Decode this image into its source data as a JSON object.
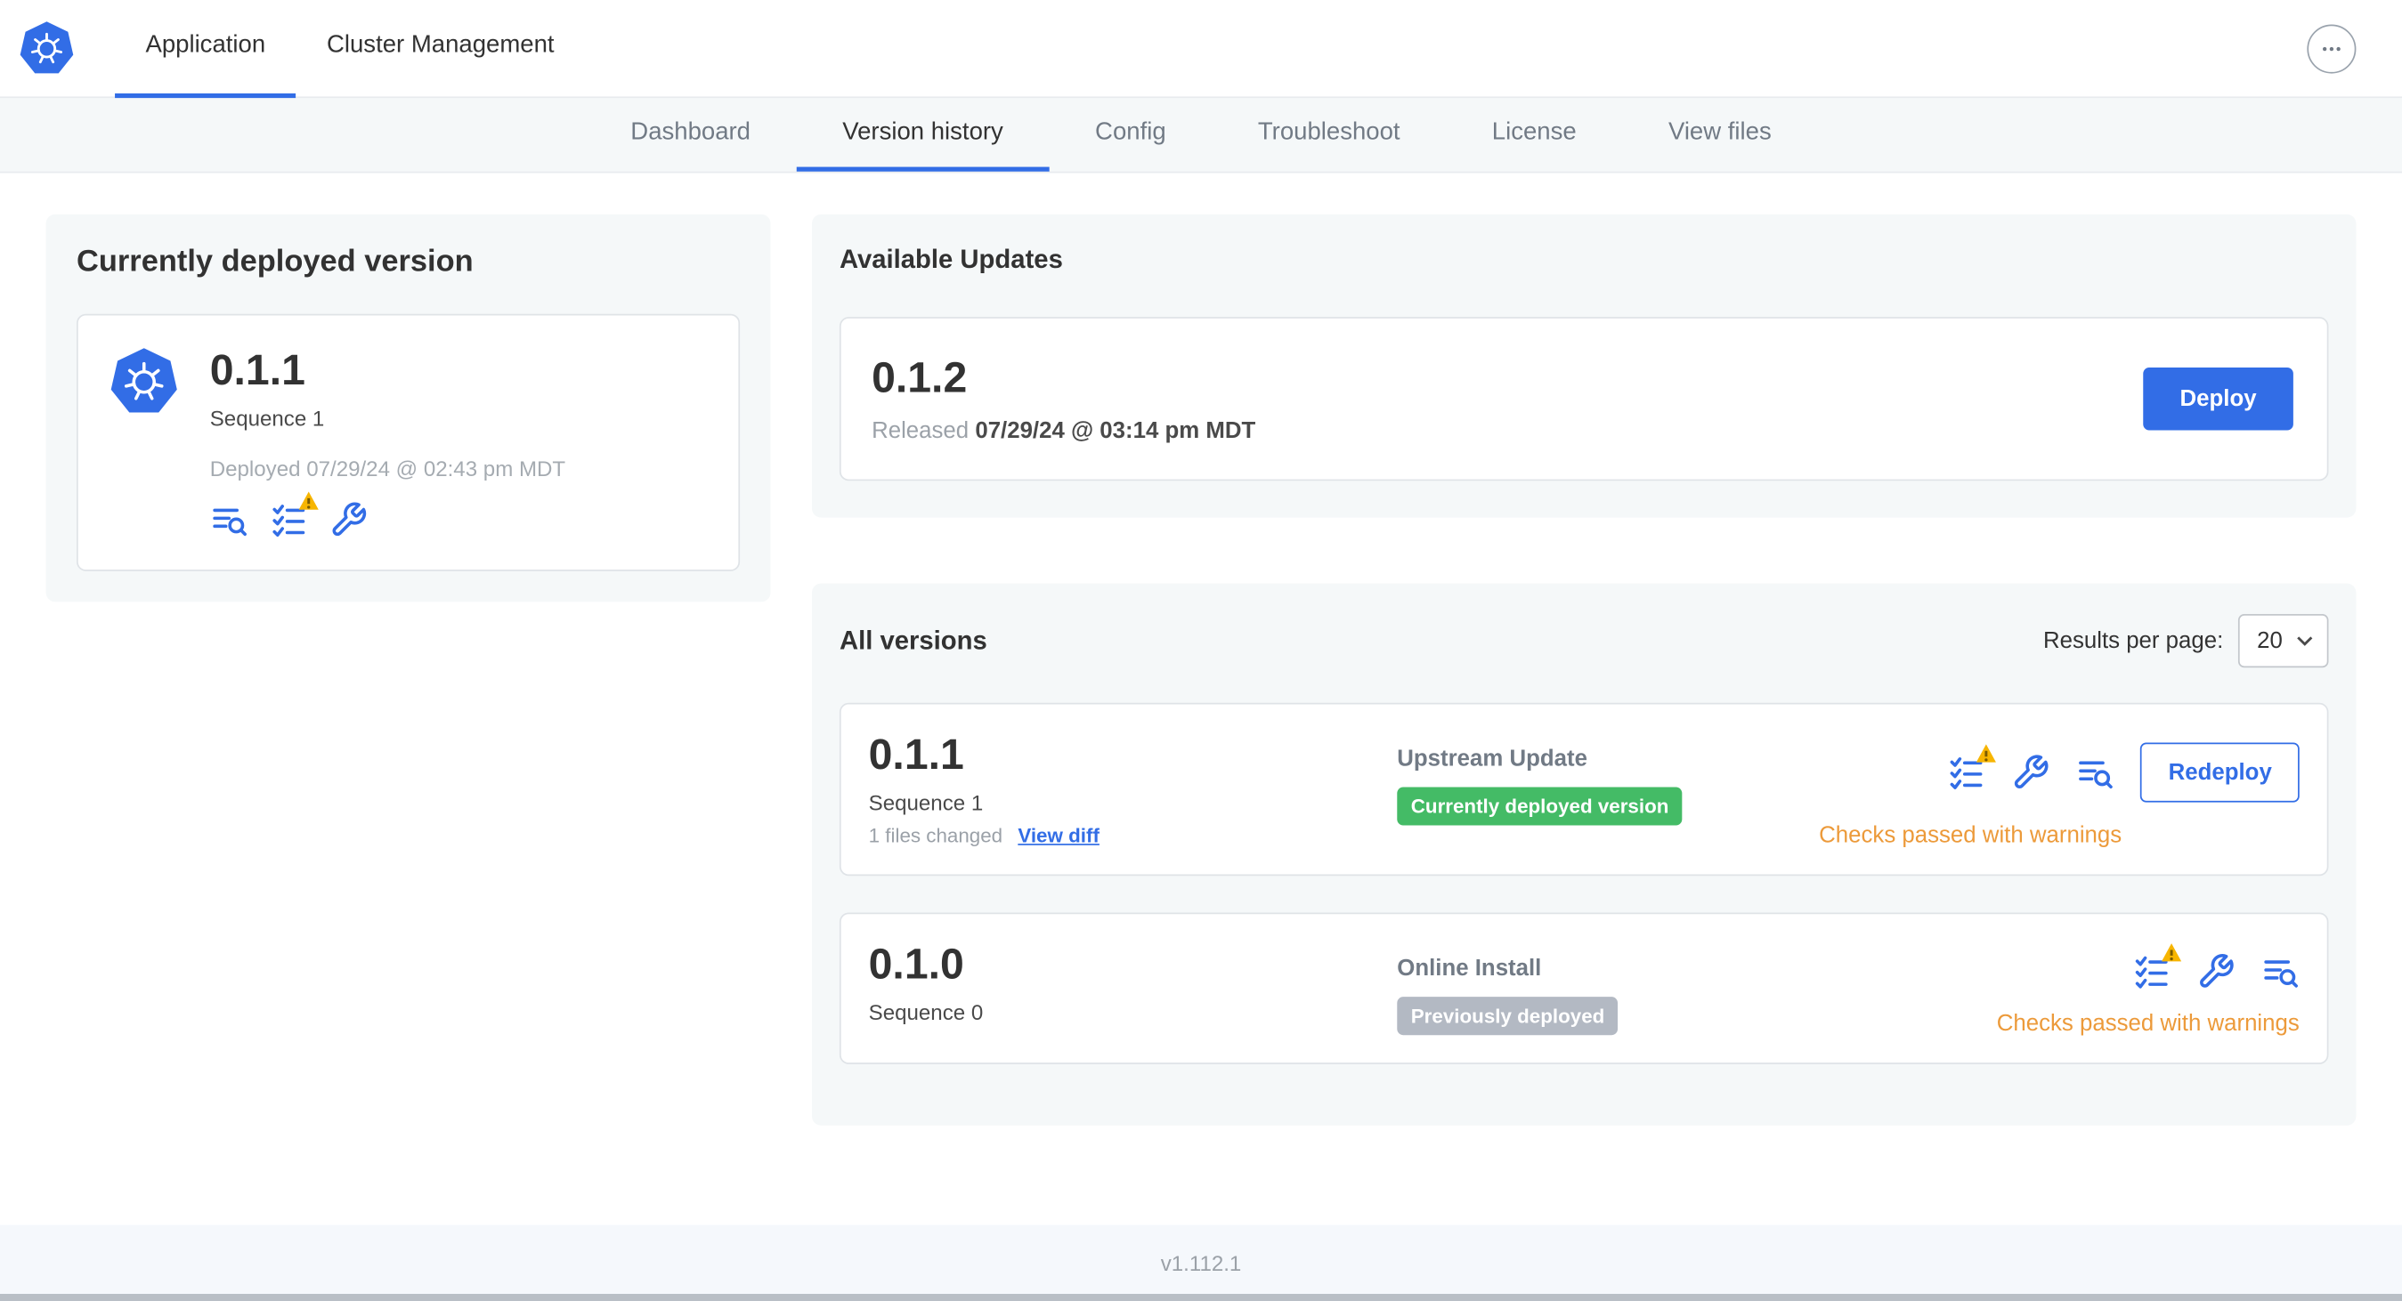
{
  "colors": {
    "accent_blue": "#326de6",
    "success_green": "#44bb66",
    "neutral_badge_gray": "#b3b9c3",
    "warning_orange": "#ec9a3a",
    "card_background": "#f5f8f9"
  },
  "top_nav": {
    "tabs": [
      {
        "label": "Application",
        "active": true
      },
      {
        "label": "Cluster Management",
        "active": false
      }
    ],
    "icons": [
      "kubernetes-logo",
      "more-menu-icon"
    ]
  },
  "sub_nav": {
    "tabs": [
      {
        "label": "Dashboard",
        "active": false
      },
      {
        "label": "Version history",
        "active": true
      },
      {
        "label": "Config",
        "active": false
      },
      {
        "label": "Troubleshoot",
        "active": false
      },
      {
        "label": "License",
        "active": false
      },
      {
        "label": "View files",
        "active": false
      }
    ]
  },
  "current_version_card": {
    "title": "Currently deployed version",
    "version": "0.1.1",
    "sequence": "Sequence 1",
    "deployed_at": "Deployed 07/29/24 @ 02:43 pm MDT",
    "icons": [
      "diff-icon",
      "preflight-checks-warning-icon",
      "wrench-icon"
    ]
  },
  "available_updates_card": {
    "title": "Available Updates",
    "version": "0.1.2",
    "released_label": "Released",
    "released_at": "07/29/24 @ 03:14 pm MDT",
    "deploy_button": "Deploy"
  },
  "all_versions_card": {
    "title": "All versions",
    "results_per_page_label": "Results per page:",
    "results_per_page_value": "20",
    "rows": [
      {
        "version": "0.1.1",
        "sequence": "Sequence 1",
        "files_changed": "1 files changed",
        "view_diff_label": "View diff",
        "source": "Upstream Update",
        "badge": "Currently deployed version",
        "badge_type": "green",
        "action_button": "Redeploy",
        "status": "Checks passed with warnings",
        "icons": [
          "preflight-checks-warning-icon",
          "wrench-icon",
          "diff-icon"
        ]
      },
      {
        "version": "0.1.0",
        "sequence": "Sequence 0",
        "source": "Online Install",
        "badge": "Previously deployed",
        "badge_type": "gray",
        "status": "Checks passed with warnings",
        "icons": [
          "preflight-checks-warning-icon",
          "wrench-icon",
          "diff-icon"
        ]
      }
    ]
  },
  "footer": {
    "app_version": "v1.112.1"
  }
}
